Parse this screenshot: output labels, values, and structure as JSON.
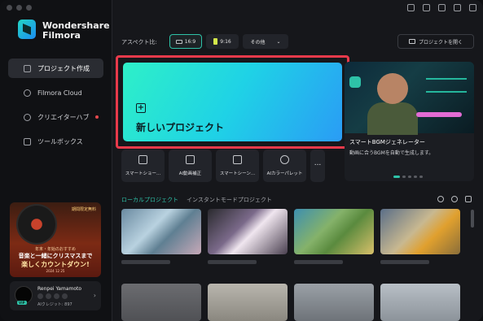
{
  "app": {
    "brand_line1": "Wondershare",
    "brand_line2": "Filmora"
  },
  "sidebar": {
    "items": [
      {
        "label": "プロジェクト作成",
        "active": true
      },
      {
        "label": "Filmora Cloud",
        "active": false
      },
      {
        "label": "クリエイターハブ",
        "active": false,
        "dot": true
      },
      {
        "label": "ツールボックス",
        "active": false
      }
    ]
  },
  "promo": {
    "tag": "期間限定無料",
    "line1": "年末・年始のおすすめ",
    "line2": "音楽と一緒にクリスマスまで",
    "line3": "楽しくカウントダウン!",
    "line4": "2024 12 25"
  },
  "user": {
    "name": "Renpei Yamamoto",
    "credits": "AIクレジット: 897",
    "badge": "VIP"
  },
  "toolbar": {
    "aspect_label": "アスペクト比:",
    "ratio_169": "16:9",
    "ratio_916": "9:16",
    "other": "その他",
    "open_project": "プロジェクトを開く"
  },
  "new_project": {
    "label": "新しいプロジェクト"
  },
  "hero": {
    "title": "スマートBGMジェネレーター",
    "desc": "動画に合うBGMを自動で生成します。"
  },
  "tools": [
    {
      "label": "スマートショー..."
    },
    {
      "label": "AI動画補正"
    },
    {
      "label": "スマートシーン..."
    },
    {
      "label": "AIカラーパレット"
    },
    {
      "label": "..."
    }
  ],
  "tabs": {
    "local": "ローカルプロジェクト",
    "instant": "インスタントモードプロジェクト"
  },
  "colors": {
    "accent": "#2ec2a8",
    "highlight_border": "#e83a4b",
    "bg": "#16171b"
  }
}
